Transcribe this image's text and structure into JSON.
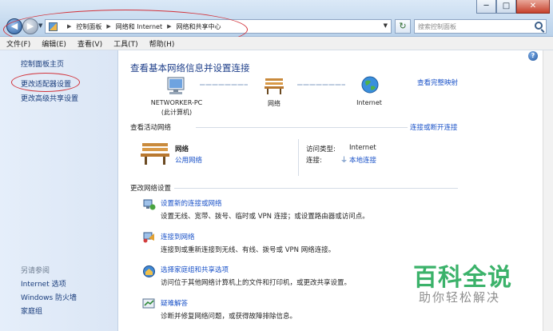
{
  "window": {
    "minimize": "─",
    "maximize": "□",
    "close": "✕"
  },
  "addressbar": {
    "crumbs": [
      "控制面板",
      "网络和 Internet",
      "网络和共享中心"
    ],
    "search_placeholder": "搜索控制面板"
  },
  "menu": [
    "文件(F)",
    "编辑(E)",
    "查看(V)",
    "工具(T)",
    "帮助(H)"
  ],
  "sidebar": {
    "links": [
      "控制面板主页",
      "更改适配器设置",
      "更改高级共享设置"
    ],
    "see_also_title": "另请参阅",
    "see_also": [
      "Internet 选项",
      "Windows 防火墙",
      "家庭组"
    ]
  },
  "main": {
    "title": "查看基本网络信息并设置连接",
    "full_map": "查看完整映射",
    "map": {
      "pc_name": "NETWORKER-PC",
      "pc_sub": "(此计算机)",
      "network": "网络",
      "internet": "Internet"
    },
    "active_title": "查看活动网络",
    "connect_link": "连接或断开连接",
    "active": {
      "name": "网络",
      "type": "公用网络",
      "access_label": "访问类型:",
      "access_value": "Internet",
      "conn_label": "连接:",
      "conn_value": "本地连接"
    },
    "change_title": "更改网络设置",
    "tasks": [
      {
        "title": "设置新的连接或网络",
        "desc": "设置无线、宽带、拨号、临时或 VPN 连接；或设置路由器或访问点。"
      },
      {
        "title": "连接到网络",
        "desc": "连接到或重新连接到无线、有线、拨号或 VPN 网络连接。"
      },
      {
        "title": "选择家庭组和共享选项",
        "desc": "访问位于其他网络计算机上的文件和打印机，或更改共享设置。"
      },
      {
        "title": "疑难解答",
        "desc": "诊断并修复网络问题，或获得故障排除信息。"
      }
    ]
  },
  "watermark": {
    "main": "百科全说",
    "sub": "助你轻松解决"
  },
  "colors": {
    "link": "#1a52c8",
    "heading": "#1e3f8a",
    "annotation": "#d2323a",
    "watermark": "#3bb26a"
  }
}
